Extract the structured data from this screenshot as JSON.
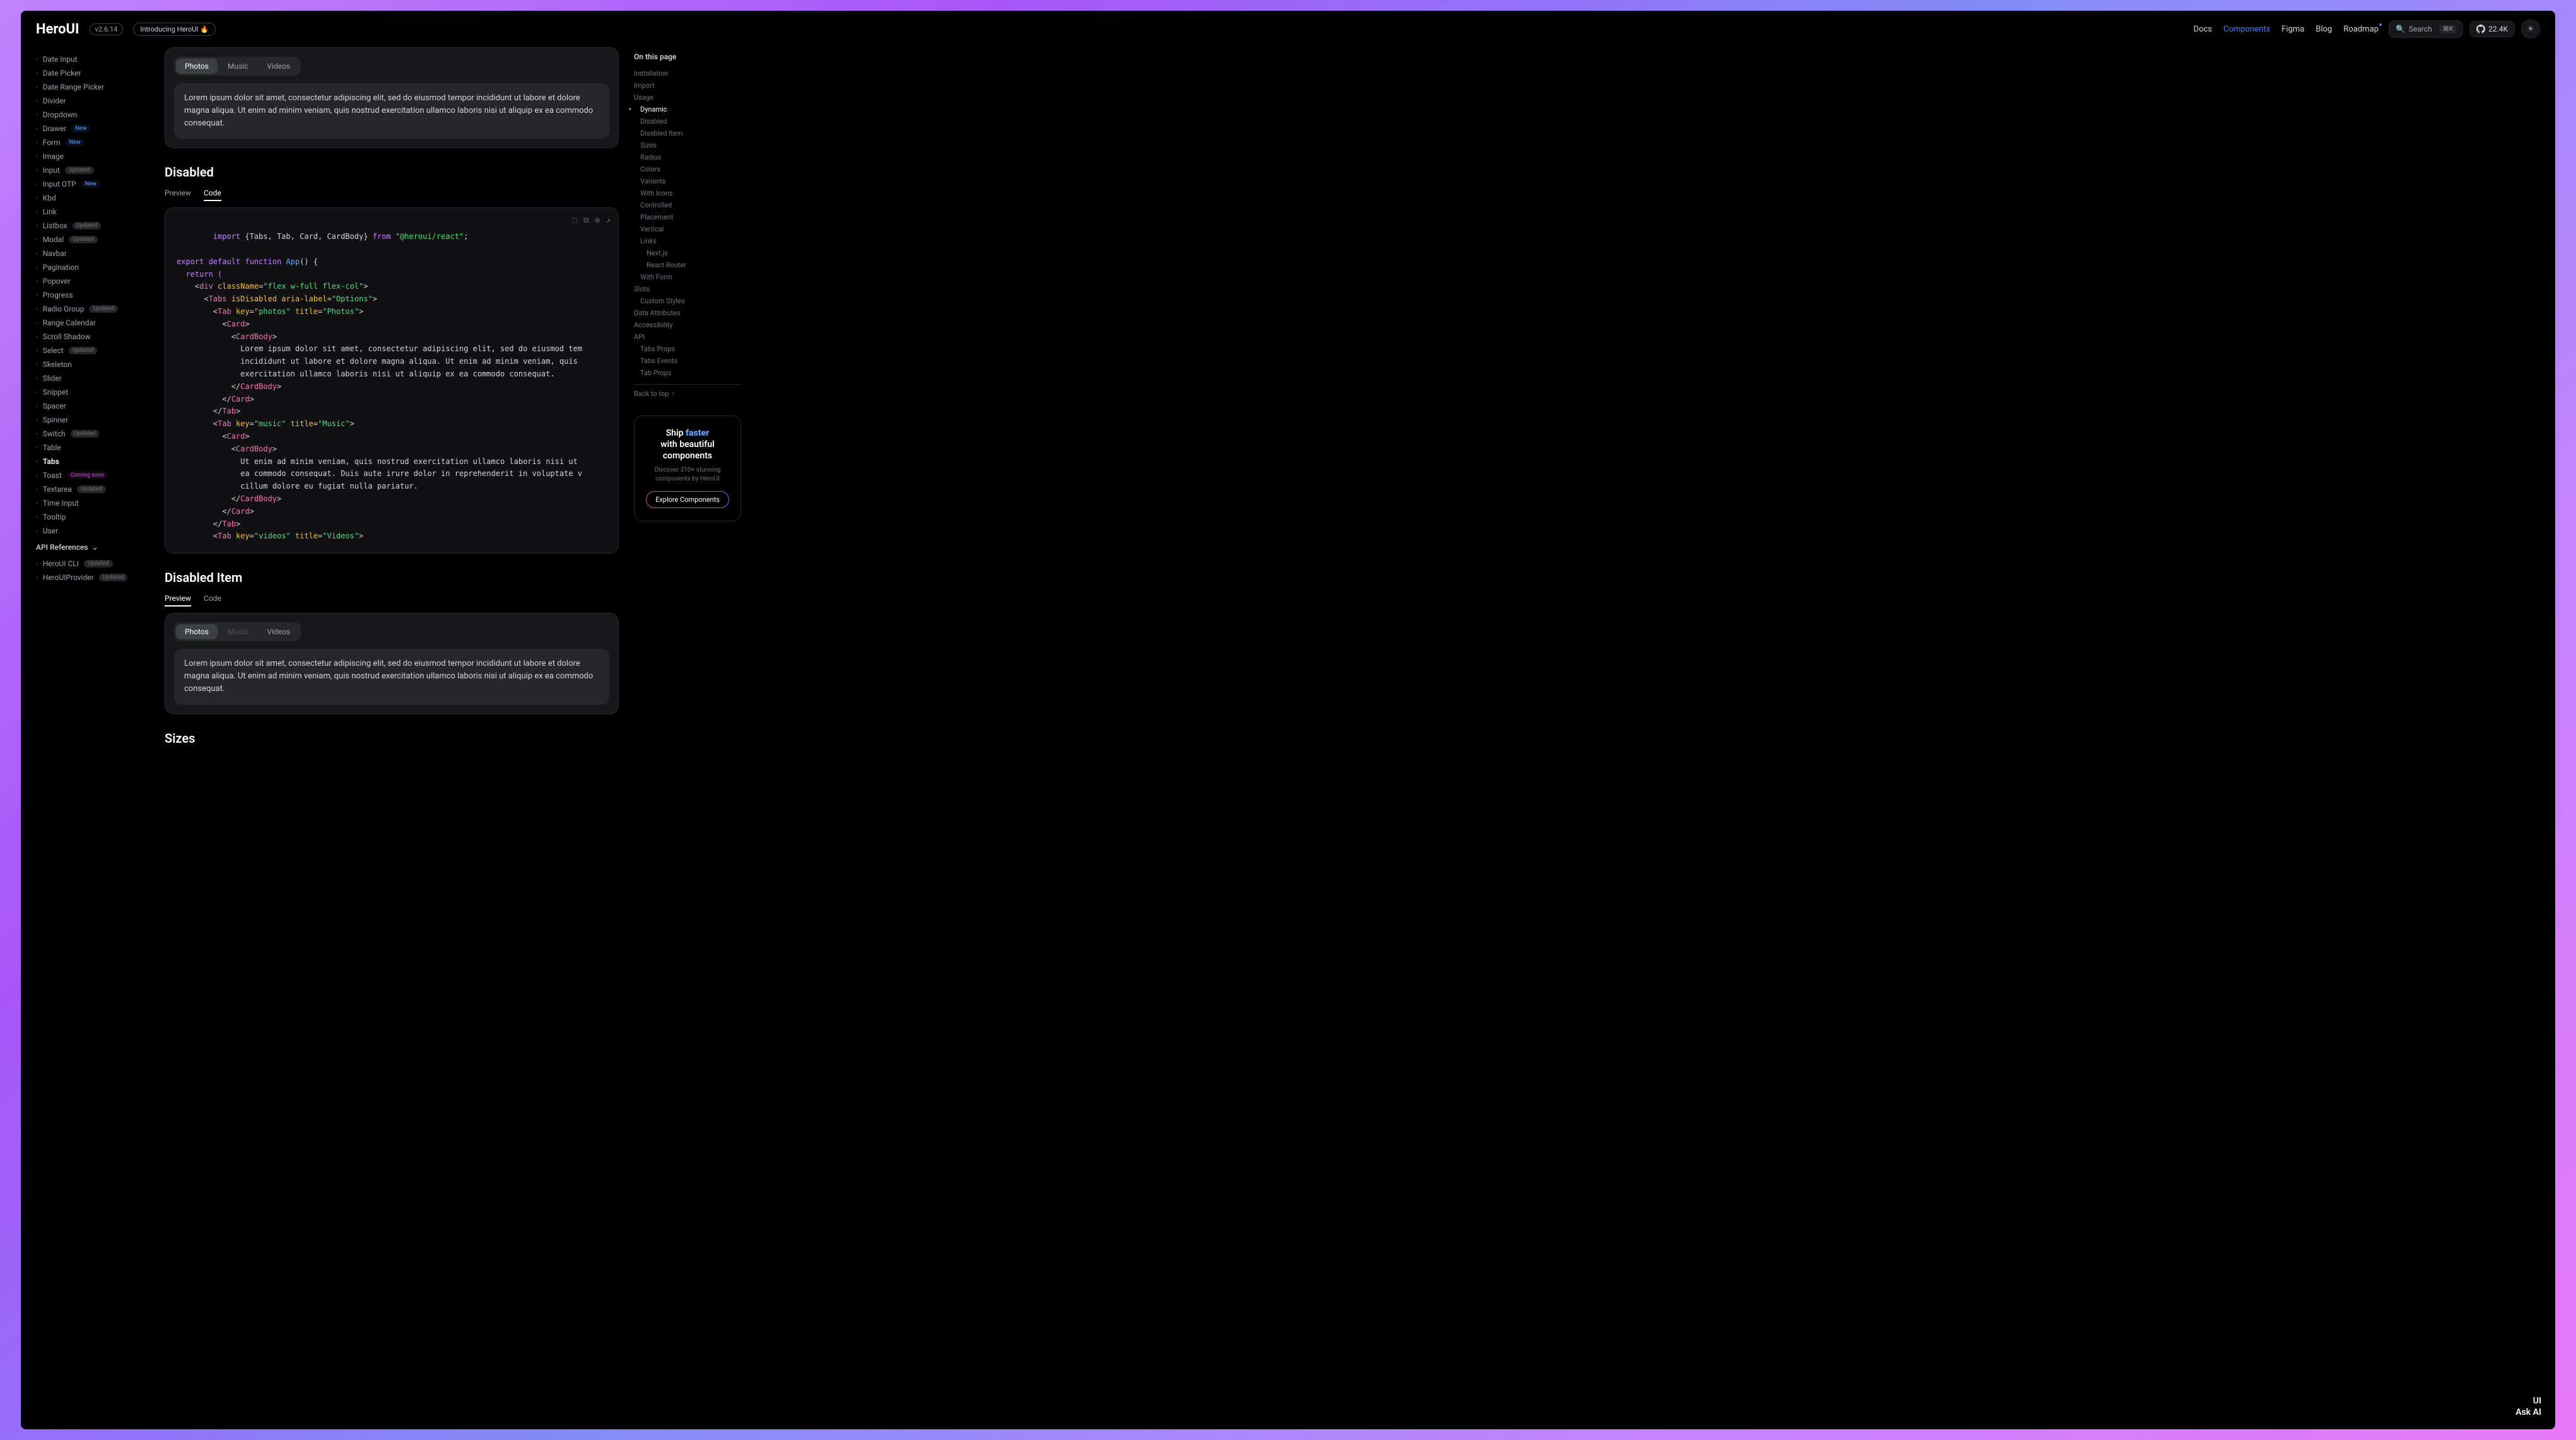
{
  "header": {
    "logo": "HeroUI",
    "version": "v2.6.14",
    "intro": "Introducing HeroUI 🔥",
    "nav": [
      "Docs",
      "Components",
      "Figma",
      "Blog",
      "Roadmap"
    ],
    "nav_active_index": 1,
    "search_label": "Search",
    "search_kbd": "⌘K",
    "gh_stars": "22.4K"
  },
  "sidebar_items": [
    {
      "label": "Date Input"
    },
    {
      "label": "Date Picker"
    },
    {
      "label": "Date Range Picker"
    },
    {
      "label": "Divider"
    },
    {
      "label": "Dropdown"
    },
    {
      "label": "Drawer",
      "badge": "New",
      "badge_type": "new"
    },
    {
      "label": "Form",
      "badge": "New",
      "badge_type": "new"
    },
    {
      "label": "Image"
    },
    {
      "label": "Input",
      "badge": "Updated"
    },
    {
      "label": "Input OTP",
      "badge": "New",
      "badge_type": "new"
    },
    {
      "label": "Kbd"
    },
    {
      "label": "Link"
    },
    {
      "label": "Listbox",
      "badge": "Updated"
    },
    {
      "label": "Modal",
      "badge": "Updated"
    },
    {
      "label": "Navbar"
    },
    {
      "label": "Pagination"
    },
    {
      "label": "Popover"
    },
    {
      "label": "Progress"
    },
    {
      "label": "Radio Group",
      "badge": "Updated"
    },
    {
      "label": "Range Calendar"
    },
    {
      "label": "Scroll Shadow"
    },
    {
      "label": "Select",
      "badge": "Updated"
    },
    {
      "label": "Skeleton"
    },
    {
      "label": "Slider"
    },
    {
      "label": "Snippet"
    },
    {
      "label": "Spacer"
    },
    {
      "label": "Spinner"
    },
    {
      "label": "Switch",
      "badge": "Updated"
    },
    {
      "label": "Table"
    },
    {
      "label": "Tabs",
      "active": true
    },
    {
      "label": "Toast",
      "badge": "Coming soon",
      "badge_type": "soon"
    },
    {
      "label": "Textarea",
      "badge": "Updated"
    },
    {
      "label": "Time Input"
    },
    {
      "label": "Tooltip"
    },
    {
      "label": "User"
    }
  ],
  "sidebar_section": "API References",
  "sidebar_sub": [
    {
      "label": "HeroUI CLI",
      "badge": "Updated"
    },
    {
      "label": "HeroUIProvider",
      "badge": "Updated"
    }
  ],
  "example1": {
    "tabs": [
      "Photos",
      "Music",
      "Videos"
    ],
    "body": "Lorem ipsum dolor sit amet, consectetur adipiscing elit, sed do eiusmod tempor incididunt ut labore et dolore magna aliqua. Ut enim ad minim veniam, quis nostrud exercitation ullamco laboris nisi ut aliquip ex ea commodo consequat."
  },
  "disabled_section": {
    "title": "Disabled",
    "tab_preview": "Preview",
    "tab_code": "Code"
  },
  "code": {
    "line1_a": "import",
    "line1_b": " {Tabs, Tab, Card, CardBody} ",
    "line1_c": "from",
    "line1_d": " \"@heroui/react\"",
    "line1_e": ";",
    "line3_a": "export default function",
    "line3_b": " App",
    "line3_c": "() {",
    "line4": "  return (",
    "line5_a": "    <",
    "line5_b": "div",
    "line5_c": " className",
    "line5_d": "=",
    "line5_e": "\"flex w-full flex-col\"",
    "line5_f": ">",
    "line6_a": "      <",
    "line6_b": "Tabs",
    "line6_c": " isDisabled aria-label",
    "line6_d": "=",
    "line6_e": "\"Options\"",
    "line6_f": ">",
    "line7_a": "        <",
    "line7_b": "Tab",
    "line7_c": " key",
    "line7_d": "=",
    "line7_e": "\"photos\"",
    "line7_f": " title",
    "line7_g": "=",
    "line7_h": "\"Photos\"",
    "line7_i": ">",
    "line8_a": "          <",
    "line8_b": "Card",
    "line8_c": ">",
    "line9_a": "            <",
    "line9_b": "CardBody",
    "line9_c": ">",
    "line10": "              Lorem ipsum dolor sit amet, consectetur adipiscing elit, sed do eiusmod tem",
    "line11": "              incididunt ut labore et dolore magna aliqua. Ut enim ad minim veniam, quis",
    "line12": "              exercitation ullamco laboris nisi ut aliquip ex ea commodo consequat.",
    "line13_a": "            </",
    "line13_b": "CardBody",
    "line13_c": ">",
    "line14_a": "          </",
    "line14_b": "Card",
    "line14_c": ">",
    "line15_a": "        </",
    "line15_b": "Tab",
    "line15_c": ">",
    "line16_a": "        <",
    "line16_b": "Tab",
    "line16_c": " key",
    "line16_d": "=",
    "line16_e": "\"music\"",
    "line16_f": " title",
    "line16_g": "=",
    "line16_h": "\"Music\"",
    "line16_i": ">",
    "line17_a": "          <",
    "line17_b": "Card",
    "line17_c": ">",
    "line18_a": "            <",
    "line18_b": "CardBody",
    "line18_c": ">",
    "line19": "              Ut enim ad minim veniam, quis nostrud exercitation ullamco laboris nisi ut",
    "line20": "              ea commodo consequat. Duis aute irure dolor in reprehenderit in voluptate v",
    "line21": "              cillum dolore eu fugiat nulla pariatur.",
    "line22_a": "            </",
    "line22_b": "CardBody",
    "line22_c": ">",
    "line23_a": "          </",
    "line23_b": "Card",
    "line23_c": ">",
    "line24_a": "        </",
    "line24_b": "Tab",
    "line24_c": ">",
    "line25_a": "        <",
    "line25_b": "Tab",
    "line25_c": " key",
    "line25_d": "=",
    "line25_e": "\"videos\"",
    "line25_f": " title",
    "line25_g": "=",
    "line25_h": "\"Videos\"",
    "line25_i": ">"
  },
  "disabled_item": {
    "title": "Disabled Item",
    "tab_preview": "Preview",
    "tab_code": "Code",
    "tabs": [
      "Photos",
      "Music",
      "Videos"
    ],
    "disabled_index": 1,
    "body": "Lorem ipsum dolor sit amet, consectetur adipiscing elit, sed do eiusmod tempor incididunt ut labore et dolore magna aliqua. Ut enim ad minim veniam, quis nostrud exercitation ullamco laboris nisi ut aliquip ex ea commodo consequat."
  },
  "next_section": "Sizes",
  "rail": {
    "title": "On this page",
    "items": [
      {
        "label": "Installation",
        "level": 1
      },
      {
        "label": "Import",
        "level": 1
      },
      {
        "label": "Usage",
        "level": 1
      },
      {
        "label": "Dynamic",
        "level": 2,
        "active": true
      },
      {
        "label": "Disabled",
        "level": 2
      },
      {
        "label": "Disabled Item",
        "level": 2
      },
      {
        "label": "Sizes",
        "level": 2
      },
      {
        "label": "Radius",
        "level": 2
      },
      {
        "label": "Colors",
        "level": 2
      },
      {
        "label": "Variants",
        "level": 2
      },
      {
        "label": "With Icons",
        "level": 2
      },
      {
        "label": "Controlled",
        "level": 2
      },
      {
        "label": "Placement",
        "level": 2
      },
      {
        "label": "Vertical",
        "level": 2
      },
      {
        "label": "Links",
        "level": 2
      },
      {
        "label": "Next.js",
        "level": 3
      },
      {
        "label": "React Router",
        "level": 3
      },
      {
        "label": "With Form",
        "level": 2
      },
      {
        "label": "Slots",
        "level": 1
      },
      {
        "label": "Custom Styles",
        "level": 2
      },
      {
        "label": "Data Attributes",
        "level": 1
      },
      {
        "label": "Accessibility",
        "level": 1
      },
      {
        "label": "API",
        "level": 1
      },
      {
        "label": "Tabs Props",
        "level": 2
      },
      {
        "label": "Tabs Events",
        "level": 2
      },
      {
        "label": "Tab Props",
        "level": 2
      }
    ],
    "back": "Back to top"
  },
  "promo": {
    "line1_a": "Ship ",
    "line1_b": "faster",
    "line2": "with beautiful",
    "line3": "components",
    "sub": "Discover 210+ stunning components by HeroUI",
    "cta": "Explore Components"
  },
  "ask": {
    "line1": "UI",
    "line2": "Ask AI"
  }
}
